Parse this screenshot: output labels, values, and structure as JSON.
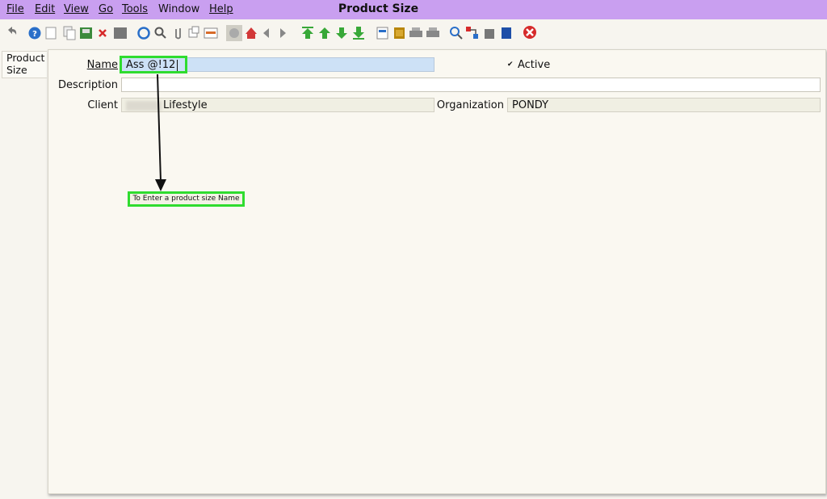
{
  "menu": {
    "file": "File",
    "edit": "Edit",
    "view": "View",
    "go": "Go",
    "tools": "Tools",
    "window": "Window",
    "help": "Help"
  },
  "window_title": "Product Size",
  "toolbar_icons": [
    "undo-icon",
    "help-icon",
    "new-record-icon",
    "copy-record-icon",
    "save-icon",
    "delete-icon",
    "grid-toggle-icon",
    "refresh-icon",
    "find-icon",
    "attachment-icon",
    "history-icon",
    "report-icon",
    "archive-icon",
    "home-icon",
    "back-icon",
    "forward-icon",
    "first-record-icon",
    "previous-record-icon",
    "next-record-icon",
    "last-record-icon",
    "print-preview-icon",
    "print-icon",
    "zoom-icon",
    "request-icon",
    "product-info-icon",
    "workflow-icon",
    "close-window-icon"
  ],
  "tab": {
    "line1": "Product",
    "line2": "Size"
  },
  "form": {
    "name_label": "Name",
    "name_value": "Ass @!12",
    "active_label": "Active",
    "active_checked": true,
    "description_label": "Description",
    "description_value": "",
    "client_label": "Client",
    "client_value": "Lifestyle",
    "organization_label": "Organization",
    "organization_value": "PONDY"
  },
  "annotation": {
    "text": "To Enter a product size Name"
  },
  "colors": {
    "menubar": "#c99ff0",
    "highlight": "#2fdc2f",
    "name_field": "#cde1f6"
  }
}
